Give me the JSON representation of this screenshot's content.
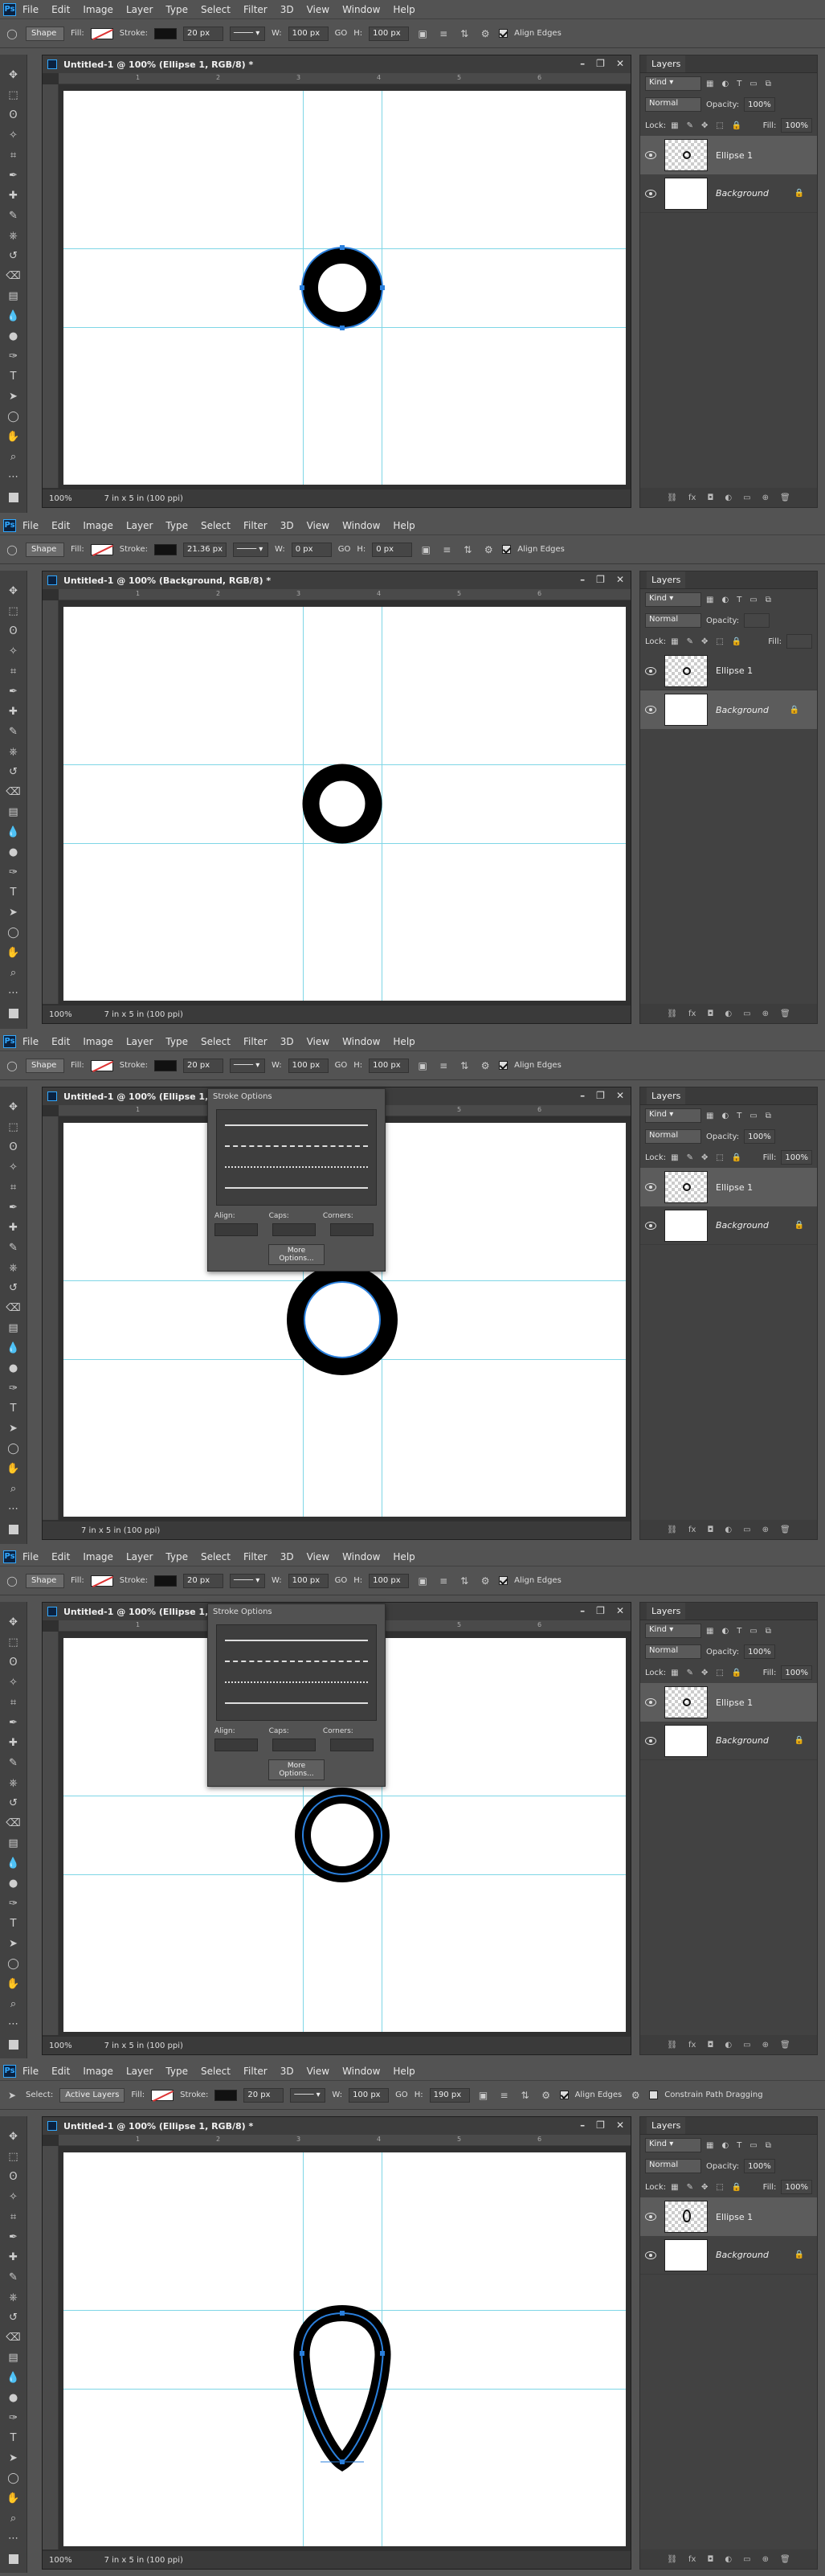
{
  "menus": [
    "File",
    "Edit",
    "Image",
    "Layer",
    "Type",
    "Select",
    "Filter",
    "3D",
    "View",
    "Window",
    "Help"
  ],
  "ps_logo": "Ps",
  "layers_tab": "Layers",
  "kind_label": "Kind",
  "layers": [
    {
      "name": "Ellipse 1",
      "italic": false
    },
    {
      "name": "Background",
      "italic": true
    }
  ],
  "frames": [
    {
      "options": {
        "mode": "Shape",
        "fill": "Fill:",
        "stroke": "Stroke:",
        "stroke_width": "20 px",
        "w_label": "W:",
        "w": "100 px",
        "go": "GO",
        "h_label": "H:",
        "h": "100 px",
        "align_edges": "Align Edges"
      },
      "doc_title": "Untitled-1 @ 100% (Ellipse 1, RGB/8) *",
      "zoom": "100%",
      "doc_size": "7 in x 5 in (100 ppi)",
      "blend": "Normal",
      "opacity_label": "Opacity:",
      "opacity": "100%",
      "lock_label": "Lock:",
      "fill_label": "Fill:",
      "fill": "100%"
    },
    {
      "options": {
        "mode": "Shape",
        "fill": "Fill:",
        "stroke": "Stroke:",
        "stroke_width": "21.36 px",
        "w_label": "W:",
        "w": "0 px",
        "go": "GO",
        "h_label": "H:",
        "h": "0 px",
        "align_edges": "Align Edges"
      },
      "doc_title": "Untitled-1 @ 100% (Background, RGB/8) *",
      "zoom": "100%",
      "doc_size": "7 in x 5 in (100 ppi)",
      "blend": "Normal",
      "opacity_label": "Opacity:",
      "opacity": "",
      "lock_label": "Lock:",
      "fill_label": "Fill:",
      "fill": ""
    },
    {
      "options": {
        "mode": "Shape",
        "fill": "Fill:",
        "stroke": "Stroke:",
        "stroke_width": "20 px",
        "w_label": "W:",
        "w": "100 px",
        "go": "GO",
        "h_label": "H:",
        "h": "100 px",
        "align_edges": "Align Edges"
      },
      "doc_title": "Untitled-1 @ 100% (Ellipse 1, RGB/8)",
      "zoom": "",
      "doc_size": "7 in x 5 in (100 ppi)",
      "blend": "Normal",
      "opacity_label": "Opacity:",
      "opacity": "100%",
      "lock_label": "Lock:",
      "fill_label": "Fill:",
      "fill": "100%"
    },
    {
      "options": {
        "mode": "Shape",
        "fill": "Fill:",
        "stroke": "Stroke:",
        "stroke_width": "20 px",
        "w_label": "W:",
        "w": "100 px",
        "go": "GO",
        "h_label": "H:",
        "h": "100 px",
        "align_edges": "Align Edges"
      },
      "doc_title": "Untitled-1 @ 100% (Ellipse 1, RGB/8)",
      "zoom": "100%",
      "doc_size": "7 in x 5 in (100 ppi)",
      "blend": "Normal",
      "opacity_label": "Opacity:",
      "opacity": "100%",
      "lock_label": "Lock:",
      "fill_label": "Fill:",
      "fill": "100%"
    },
    {
      "options": {
        "select_label": "Select:",
        "select": "Active Layers",
        "fill": "Fill:",
        "stroke": "Stroke:",
        "stroke_width": "20 px",
        "w_label": "W:",
        "w": "100 px",
        "go": "GO",
        "h_label": "H:",
        "h": "190 px",
        "align_edges": "Align Edges",
        "constrain": "Constrain Path Dragging"
      },
      "doc_title": "Untitled-1 @ 100% (Ellipse 1, RGB/8) *",
      "zoom": "100%",
      "doc_size": "7 in x 5 in (100 ppi)",
      "blend": "Normal",
      "opacity_label": "Opacity:",
      "opacity": "100%",
      "lock_label": "Lock:",
      "fill_label": "Fill:",
      "fill": "100%"
    }
  ],
  "stroke_options": {
    "title": "Stroke Options",
    "align": "Align:",
    "caps": "Caps:",
    "corners": "Corners:",
    "more": "More Options..."
  },
  "ruler_labels": [
    "1",
    "2",
    "3",
    "4",
    "5",
    "6"
  ]
}
